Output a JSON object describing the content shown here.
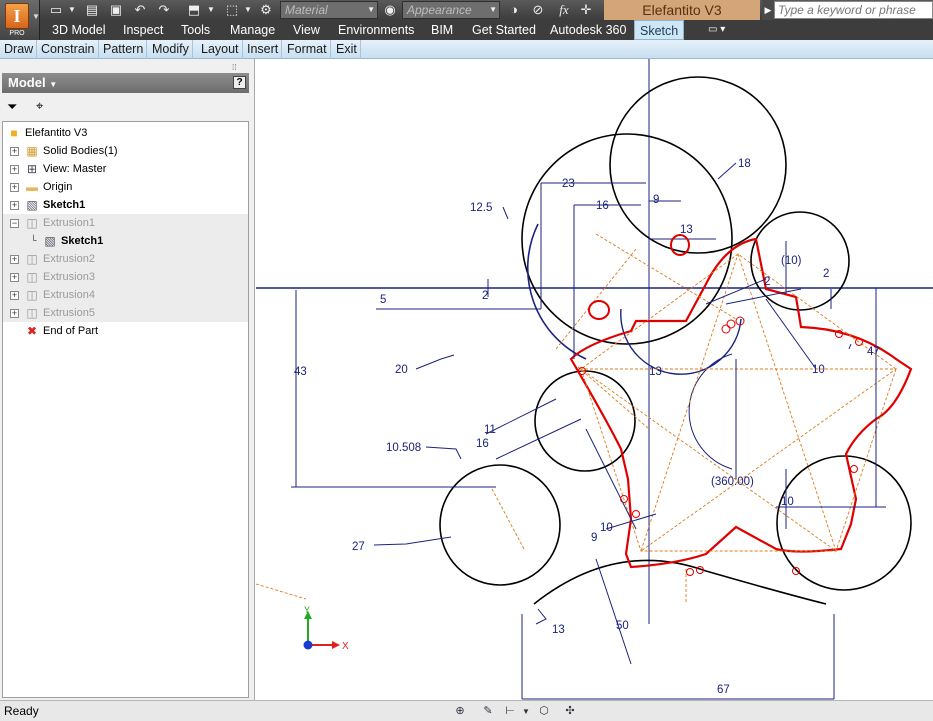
{
  "app": {
    "pro_label": "PRO",
    "material_placeholder": "Material",
    "appearance_placeholder": "Appearance",
    "fx_label": "fx",
    "document_title": "Elefantito V3",
    "search_placeholder": "Type a keyword or phrase"
  },
  "ribbon": {
    "tabs": [
      "3D Model",
      "Inspect",
      "Tools",
      "Manage",
      "View",
      "Environments",
      "BIM",
      "Get Started",
      "Autodesk 360",
      "Sketch"
    ],
    "active_tab": "Sketch"
  },
  "panels": [
    "Draw",
    "Constrain",
    "Pattern",
    "Modify",
    "Layout",
    "Insert",
    "Format",
    "Exit"
  ],
  "browser": {
    "title": "Model",
    "help_label": "?",
    "items": [
      {
        "label": "Elefantito V3",
        "icon": "part-icon",
        "level": 0,
        "style": "normal"
      },
      {
        "label": "Solid Bodies(1)",
        "icon": "solid-bodies-icon",
        "level": 1,
        "style": "normal"
      },
      {
        "label": "View: Master",
        "icon": "view-icon",
        "level": 1,
        "style": "normal"
      },
      {
        "label": "Origin",
        "icon": "folder-icon",
        "level": 1,
        "style": "normal"
      },
      {
        "label": "Sketch1",
        "icon": "sketch-icon",
        "level": 1,
        "style": "bold"
      },
      {
        "label": "Extrusion1",
        "icon": "extrusion-icon",
        "level": 1,
        "style": "dim"
      },
      {
        "label": "Sketch1",
        "icon": "sketch-icon",
        "level": 2,
        "style": "bold"
      },
      {
        "label": "Extrusion2",
        "icon": "extrusion-icon",
        "level": 1,
        "style": "dim"
      },
      {
        "label": "Extrusion3",
        "icon": "extrusion-icon",
        "level": 1,
        "style": "dim"
      },
      {
        "label": "Extrusion4",
        "icon": "extrusion-icon",
        "level": 1,
        "style": "dim"
      },
      {
        "label": "Extrusion5",
        "icon": "extrusion-icon",
        "level": 1,
        "style": "dim"
      },
      {
        "label": "End of Part",
        "icon": "end-of-part-icon",
        "level": 1,
        "style": "normal"
      }
    ]
  },
  "sketch": {
    "dimensions": [
      "23",
      "9",
      "16",
      "13",
      "18",
      "12.5",
      "2",
      "5",
      "(10)",
      "2",
      "2",
      "43",
      "20",
      "13",
      "10",
      "47",
      "11",
      "16",
      "10.508",
      "(360.00)",
      "10",
      "10",
      "9",
      "27",
      "13",
      "50",
      "67"
    ],
    "axis_x_label": "X",
    "axis_y_label": "Y"
  },
  "status": {
    "text": "Ready"
  },
  "colors": {
    "sketch_line": "#000000",
    "dimension": "#1a237e",
    "profile": "#e00000",
    "construction": "#e07a1a",
    "axis_x": "#e02020",
    "axis_y": "#22aa22"
  }
}
